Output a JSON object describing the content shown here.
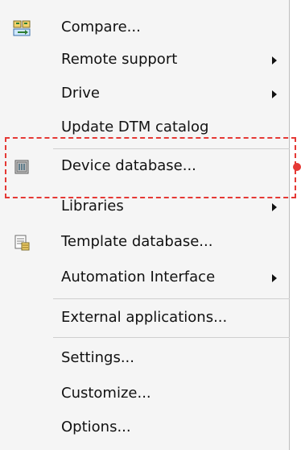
{
  "menu": {
    "items": [
      {
        "label": "Compare...",
        "icon": "compare-icon",
        "submenu": false
      },
      {
        "label": "Remote support",
        "icon": null,
        "submenu": true
      },
      {
        "label": "Drive",
        "icon": null,
        "submenu": true
      },
      {
        "label": "Update DTM catalog",
        "icon": null,
        "submenu": false
      },
      {
        "label": "Device database...",
        "icon": "device-database-icon",
        "submenu": false
      },
      {
        "label": "Libraries",
        "icon": null,
        "submenu": true
      },
      {
        "label": "Template database...",
        "icon": "template-database-icon",
        "submenu": false
      },
      {
        "label": "Automation Interface",
        "icon": null,
        "submenu": true
      },
      {
        "label": "External applications...",
        "icon": null,
        "submenu": false
      },
      {
        "label": "Settings...",
        "icon": null,
        "submenu": false
      },
      {
        "label": "Customize...",
        "icon": null,
        "submenu": false
      },
      {
        "label": "Options...",
        "icon": null,
        "submenu": false
      }
    ]
  },
  "annotation": {
    "highlight_color": "#e53935",
    "highlighted_item": "Device database..."
  }
}
